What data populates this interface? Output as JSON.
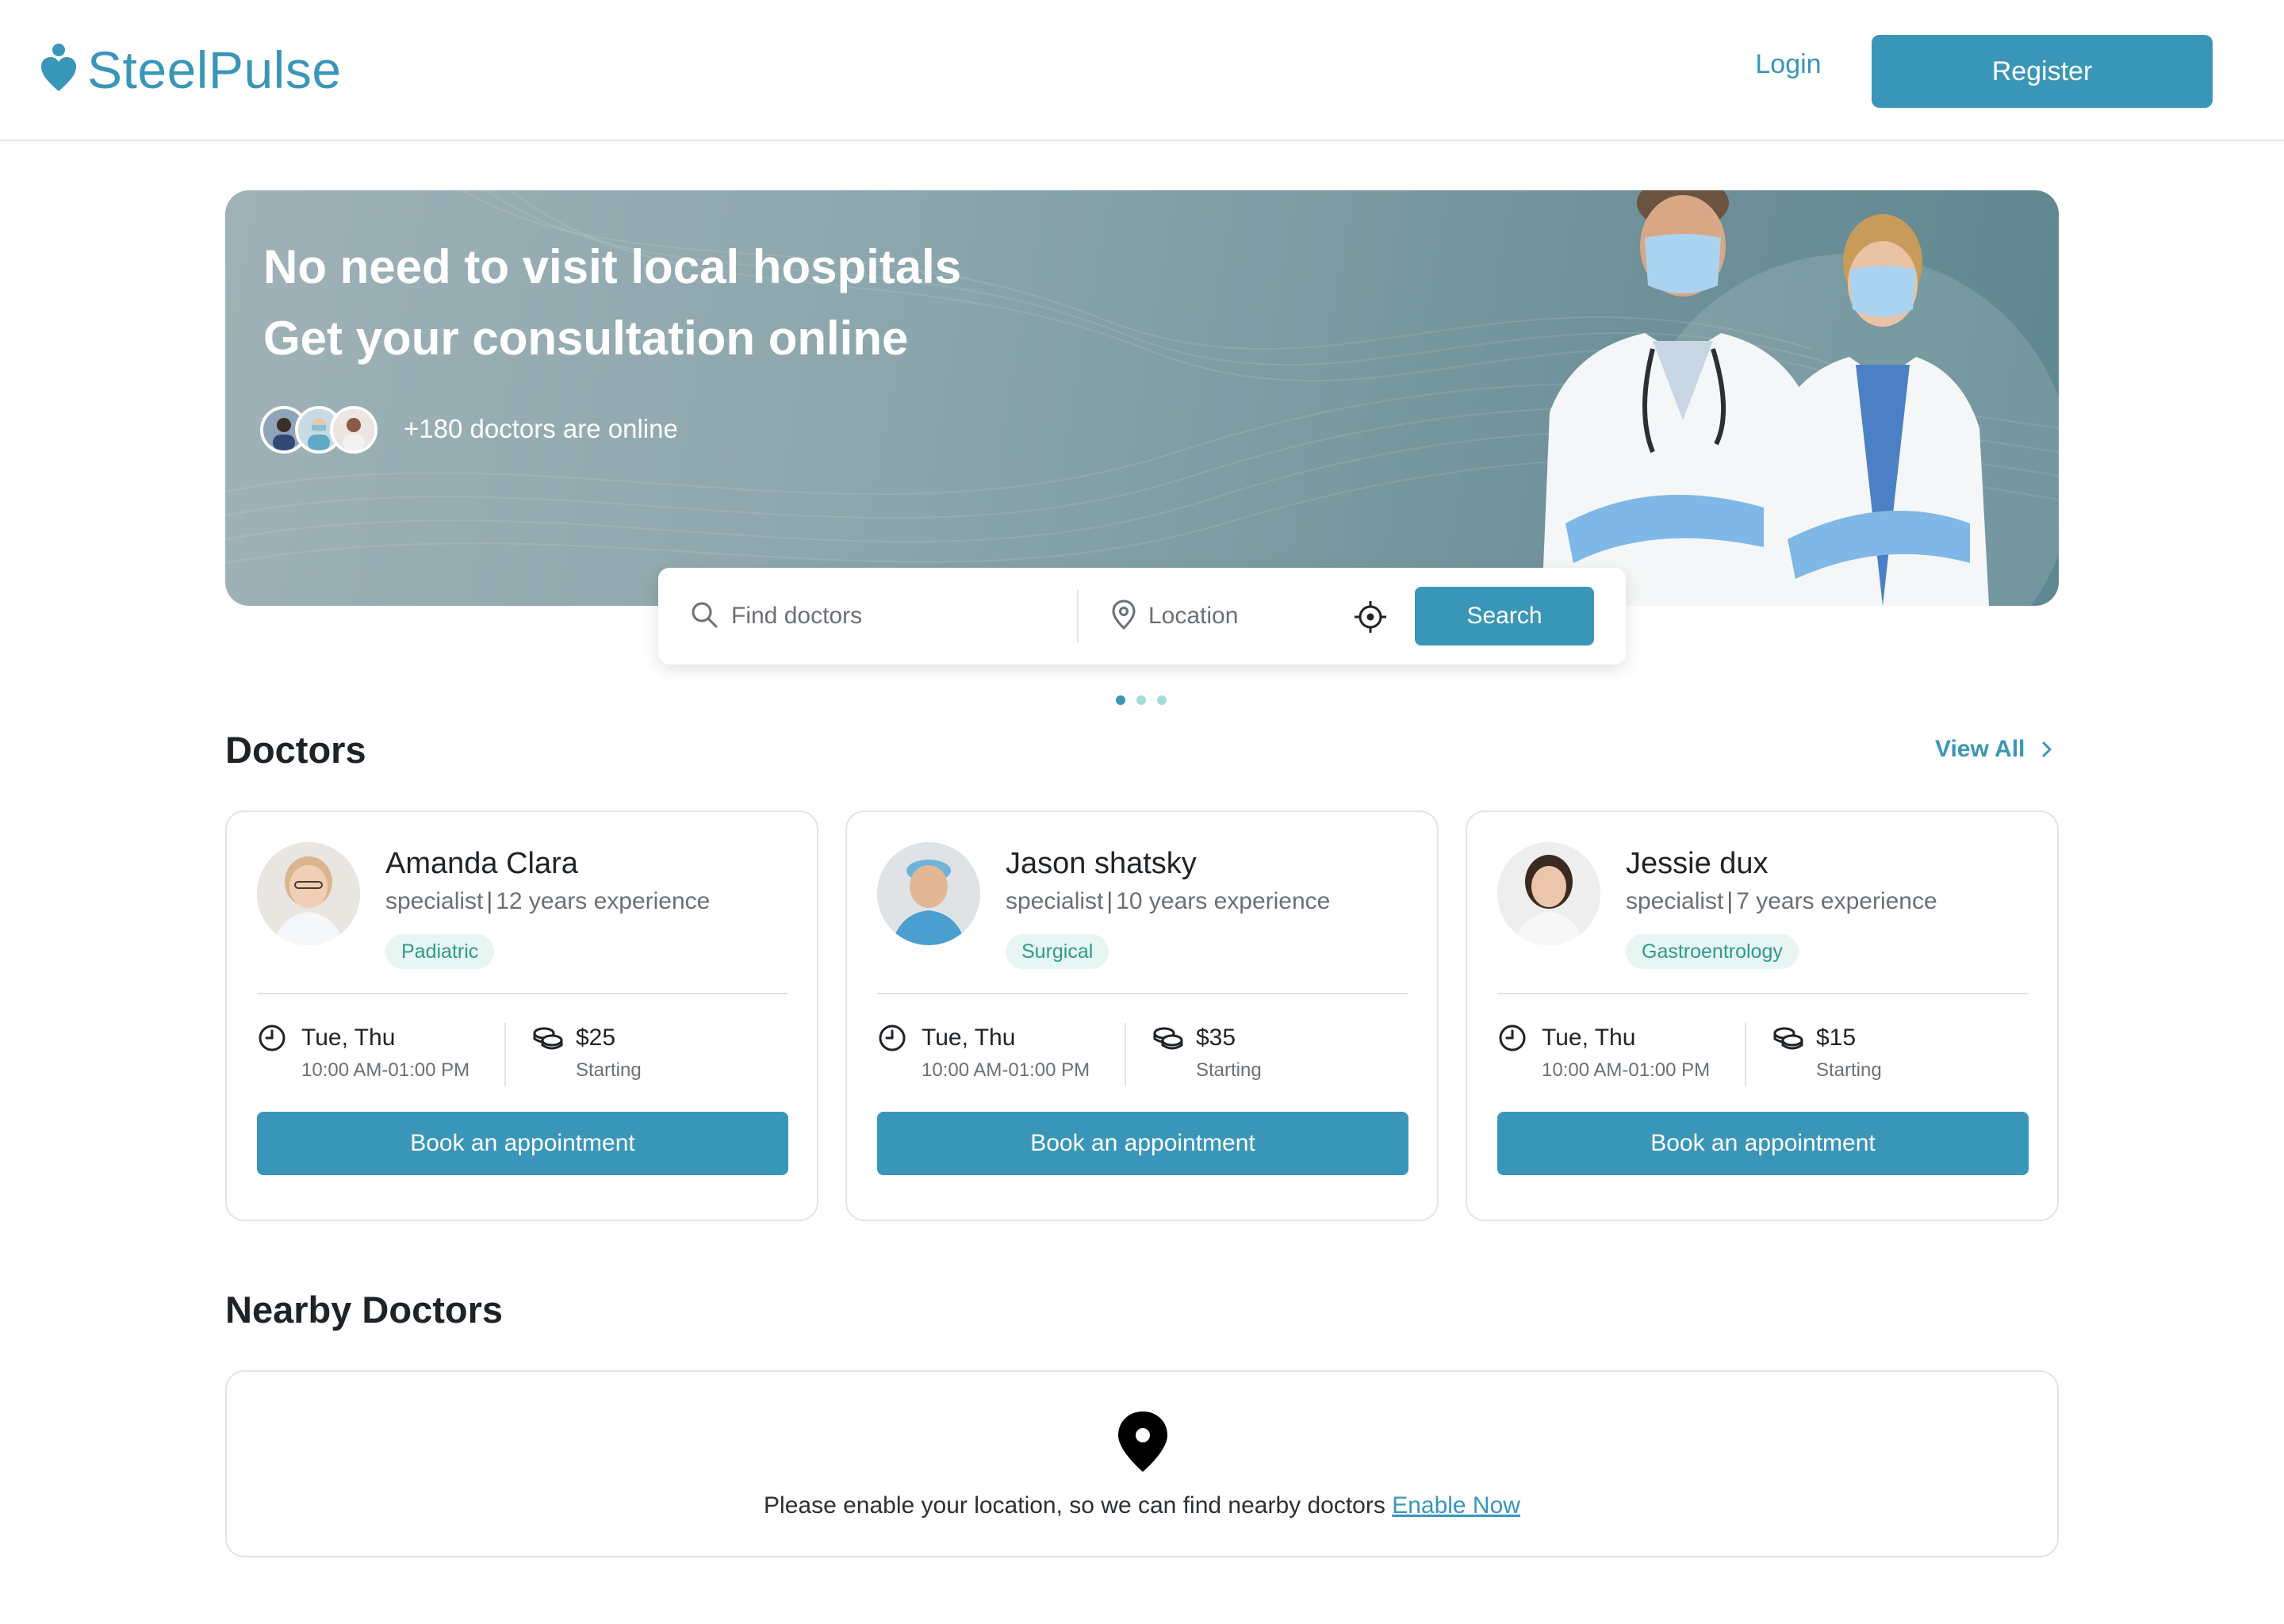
{
  "header": {
    "brand": "SteelPulse",
    "login_label": "Login",
    "register_label": "Register"
  },
  "hero": {
    "title_line1": "No need to visit local hospitals",
    "title_line2": "Get your consultation online",
    "online_text": "+180 doctors are online"
  },
  "search": {
    "find_placeholder": "Find doctors",
    "location_placeholder": "Location",
    "search_label": "Search"
  },
  "carousel": {
    "count": 3,
    "active": 0
  },
  "doctors_section": {
    "title": "Doctors",
    "view_all_label": "View All",
    "cards": [
      {
        "name": "Amanda Clara",
        "role": "specialist",
        "experience": "12 years experience",
        "tag": "Padiatric",
        "days": "Tue, Thu",
        "time": "10:00 AM-01:00 PM",
        "price": "$25",
        "price_sub": "Starting",
        "book_label": "Book an appointment"
      },
      {
        "name": "Jason shatsky",
        "role": "specialist",
        "experience": "10 years experience",
        "tag": "Surgical",
        "days": "Tue, Thu",
        "time": "10:00 AM-01:00 PM",
        "price": "$35",
        "price_sub": "Starting",
        "book_label": "Book an appointment"
      },
      {
        "name": "Jessie dux",
        "role": "specialist",
        "experience": "7 years experience",
        "tag": "Gastroentrology",
        "days": "Tue, Thu",
        "time": "10:00 AM-01:00 PM",
        "price": "$15",
        "price_sub": "Starting",
        "book_label": "Book an appointment"
      }
    ]
  },
  "nearby": {
    "title": "Nearby Doctors",
    "message": "Please enable your location, so we can find nearby doctors",
    "enable_label": "Enable Now"
  },
  "colors": {
    "brand": "#3a96b8",
    "tag_bg": "#e7f6f3",
    "tag_text": "#2e9a8a"
  },
  "icons": [
    "heart-pulse-logo-icon",
    "search-icon",
    "location-pin-icon",
    "target-icon",
    "clock-icon",
    "coins-icon",
    "chevron-right-icon",
    "map-pin-icon"
  ]
}
